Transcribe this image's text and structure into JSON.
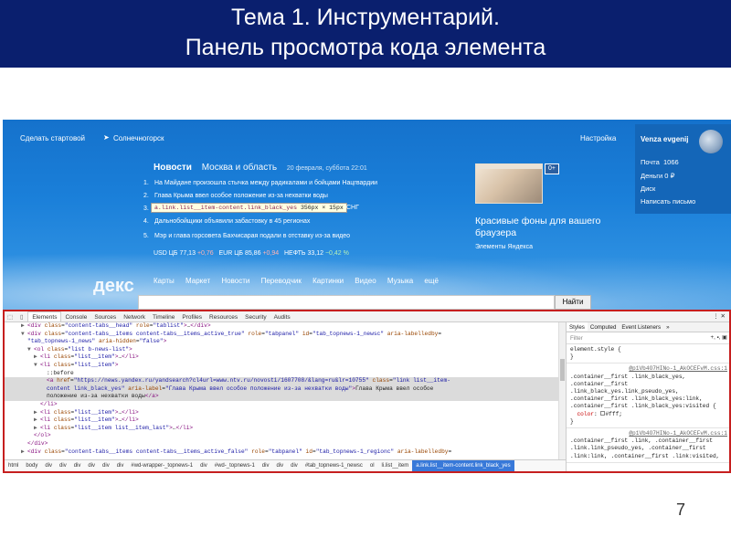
{
  "slide": {
    "title_line1": "Тема 1. Инструментарий.",
    "title_line2": "Панель просмотра кода элемента",
    "page_number": "7"
  },
  "yandex": {
    "make_home": "Сделать стартовой",
    "location": "Солнечногорск",
    "settings": "Настройка",
    "user": {
      "name": "Venza evgenij",
      "mail_label": "Почта",
      "mail_count": "1066",
      "money": "Деньги  0 ₽",
      "disk": "Диск",
      "compose": "Написать письмо"
    },
    "news": {
      "tab_news": "Новости",
      "tab_region": "Москва и область",
      "date": "20 февраля, суббота 22:01",
      "items": [
        {
          "n": "1.",
          "text": "На Майдане произошла стычка между радикалами и бойцами Нацгвардии"
        },
        {
          "n": "2.",
          "text": "Глава Крыма ввел особое положение из-за нехватки воды"
        },
        {
          "n": "3.",
          "text": ""
        },
        {
          "n": "4.",
          "text": "Дальнобойщики объявили забастовку в 45 регионах"
        },
        {
          "n": "5.",
          "text": "Мэр и глава горсовета Бахчисарая подали в отставку из-за видео"
        }
      ],
      "sng": "СНГ",
      "tooltip_tag": "a",
      "tooltip_class": ".link.list__item-content.link_black_yes",
      "tooltip_size": "356px × 15px"
    },
    "rates": {
      "usd_label": "USD ЦБ",
      "usd_value": "77,13",
      "usd_change": "+0,76",
      "eur_label": "EUR ЦБ",
      "eur_value": "85,86",
      "eur_change": "+0,94",
      "oil_label": "НЕФТЬ",
      "oil_value": "33,12",
      "oil_change": "−0,42 %"
    },
    "ad": {
      "badge": "0+",
      "title": "Красивые фоны для вашего браузера",
      "subtitle": "Элементы Яндекса"
    },
    "logo_text": "декс",
    "nav": [
      "Карты",
      "Маркет",
      "Новости",
      "Переводчик",
      "Картинки",
      "Видео",
      "Музыка",
      "ещё"
    ],
    "find_button": "Найти"
  },
  "devtools": {
    "tabs": [
      "Elements",
      "Console",
      "Sources",
      "Network",
      "Timeline",
      "Profiles",
      "Resources",
      "Security",
      "Audits"
    ],
    "active_tab": "Elements",
    "lines": [
      {
        "indent": 2,
        "arrow": "▶",
        "html": "<span class='tag'>&lt;div</span> <span class='attr'>class</span>=<span class='val'>\"content-tabs__head\"</span> <span class='attr'>role</span>=<span class='val'>\"tablist\"</span><span class='tag'>&gt;</span>…<span class='tag'>&lt;/div&gt;</span>"
      },
      {
        "indent": 2,
        "arrow": "▼",
        "html": "<span class='tag'>&lt;div</span> <span class='attr'>class</span>=<span class='val'>\"content-tabs__items content-tabs__items_active_true\"</span> <span class='attr'>role</span>=<span class='val'>\"tabpanel\"</span> <span class='attr'>id</span>=<span class='val'>\"tab_topnews-1_newsc\"</span> <span class='attr'>aria-labelledby</span>="
      },
      {
        "indent": 2,
        "arrow": "",
        "html": "<span class='val'>\"tab_topnews-1_news\"</span> <span class='attr'>aria-hidden</span>=<span class='val'>\"false\"</span><span class='tag'>&gt;</span>"
      },
      {
        "indent": 3,
        "arrow": "▼",
        "html": "<span class='tag'>&lt;ol</span> <span class='attr'>class</span>=<span class='val'>\"list b-news-list\"</span><span class='tag'>&gt;</span>"
      },
      {
        "indent": 4,
        "arrow": "▶",
        "html": "<span class='tag'>&lt;li</span> <span class='attr'>class</span>=<span class='val'>\"list__item\"</span><span class='tag'>&gt;</span>…<span class='tag'>&lt;/li&gt;</span>"
      },
      {
        "indent": 4,
        "arrow": "▼",
        "html": "<span class='tag'>&lt;li</span> <span class='attr'>class</span>=<span class='val'>\"list__item\"</span><span class='tag'>&gt;</span>"
      },
      {
        "indent": 5,
        "arrow": "",
        "html": "<span class='txt'>::before</span>"
      },
      {
        "indent": 5,
        "arrow": "",
        "selected": true,
        "html": "<span class='tag'>&lt;a</span> <span class='attr'>href</span>=<span class='val'>\"https://news.yandex.ru/yandsearch?cl4url=www.ntv.ru/novosti/1607708/&amp;lang=ru&amp;lr=10755\"</span> <span class='attr'>class</span>=<span class='val'>\"link list__item-</span>"
      },
      {
        "indent": 5,
        "arrow": "",
        "selected": true,
        "html": "<span class='val'>content link_black_yes\"</span> <span class='attr'>aria-label</span>=<span class='val'>\"Глава Крыма ввел особое положение из-за нехватки воды\"</span><span class='tag'>&gt;</span><span class='txt'>Глава Крыма ввел особое</span>"
      },
      {
        "indent": 5,
        "arrow": "",
        "selected": true,
        "html": "<span class='txt'>положение из-за нехватки воды</span><span class='tag'>&lt;/a&gt;</span>"
      },
      {
        "indent": 4,
        "arrow": "",
        "html": "<span class='tag'>&lt;/li&gt;</span>"
      },
      {
        "indent": 4,
        "arrow": "▶",
        "html": "<span class='tag'>&lt;li</span> <span class='attr'>class</span>=<span class='val'>\"list__item\"</span><span class='tag'>&gt;</span>…<span class='tag'>&lt;/li&gt;</span>"
      },
      {
        "indent": 4,
        "arrow": "▶",
        "html": "<span class='tag'>&lt;li</span> <span class='attr'>class</span>=<span class='val'>\"list__item\"</span><span class='tag'>&gt;</span>…<span class='tag'>&lt;/li&gt;</span>"
      },
      {
        "indent": 4,
        "arrow": "▶",
        "html": "<span class='tag'>&lt;li</span> <span class='attr'>class</span>=<span class='val'>\"list__item list__item_last\"</span><span class='tag'>&gt;</span>…<span class='tag'>&lt;/li&gt;</span>"
      },
      {
        "indent": 3,
        "arrow": "",
        "html": "<span class='tag'>&lt;/ol&gt;</span>"
      },
      {
        "indent": 2,
        "arrow": "",
        "html": "<span class='tag'>&lt;/div&gt;</span>"
      },
      {
        "indent": 2,
        "arrow": "▶",
        "html": "<span class='tag'>&lt;div</span> <span class='attr'>class</span>=<span class='val'>\"content-tabs__items content-tabs__items_active_false\"</span> <span class='attr'>role</span>=<span class='val'>\"tabpanel\"</span> <span class='attr'>id</span>=<span class='val'>\"tab_topnews-1_regionc\"</span> <span class='attr'>aria-labelledby</span>="
      }
    ],
    "breadcrumb": [
      "html",
      "body",
      "div",
      "div",
      "div",
      "div",
      "div",
      "div",
      "#wd-wrapper-_topnews-1",
      "div",
      "#wd-_topnews-1",
      "div",
      "div",
      "div",
      "#tab_topnews-1_newsc",
      "ol",
      "li.list__item",
      "a.link.list__item-content.link_black_yes"
    ],
    "styles": {
      "tabs": [
        "Styles",
        "Computed",
        "Event Listeners",
        "»"
      ],
      "filter": "Filter",
      "tools": "+, ▪, ▣",
      "element_style": "element.style {",
      "element_style_close": "}",
      "src": "@p1Vb4O7HINo-1_AkOCEFvM.css:1",
      "rule1_selectors": ".container__first .link_black_yes, .container__first .link_black_yes.link_pseudo_yes, .container__first .link_black_yes:link, .container__first .link_black_yes:visited {",
      "rule1_prop": "color",
      "rule1_val": "#fff;",
      "rule1_close": "}",
      "src2": "@p1Vb4O7HINo-1_AkOCEFvM.css:1",
      "rule2_selectors": ".container__first .link, .container__first .link.link_pseudo_yes, .container__first .link:link, .container__first .link:visited,"
    }
  }
}
